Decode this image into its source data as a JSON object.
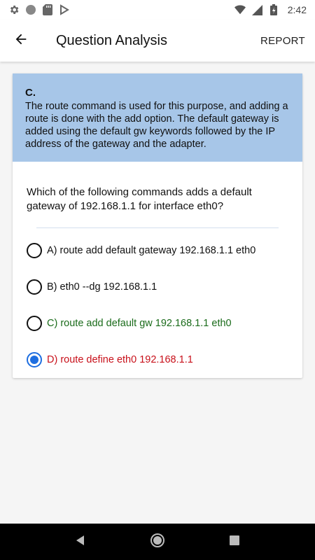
{
  "status_bar": {
    "time": "2:42",
    "icons": [
      "gear-icon",
      "circle-icon",
      "sd-card-icon",
      "play-store-icon",
      "wifi-icon",
      "signal-icon",
      "battery-icon"
    ]
  },
  "app_bar": {
    "title": "Question Analysis",
    "action": "REPORT",
    "back_icon": "arrow-back-icon"
  },
  "answer": {
    "letter": "C.",
    "explanation": "The route command is used for this purpose, and adding a route is done with the add option. The default gateway is added using the default gw keywords followed by the IP address of the gateway and the adapter.",
    "background": "#a7c6e8"
  },
  "question": {
    "text": "Which of the following commands adds a default gateway of 192.168.1.1 for interface eth0?",
    "options": [
      {
        "label": "A) route add default gateway 192.168.1.1 eth0",
        "selected": false,
        "state": "neutral"
      },
      {
        "label": "B) eth0 --dg 192.168.1.1",
        "selected": false,
        "state": "neutral"
      },
      {
        "label": "C) route add default gw 192.168.1.1 eth0",
        "selected": false,
        "state": "correct"
      },
      {
        "label": "D) route define eth0 192.168.1.1",
        "selected": true,
        "state": "wrong"
      }
    ]
  },
  "colors": {
    "correct": "#1a6b1a",
    "wrong": "#c8101a",
    "radio_selected": "#1e6ee0"
  },
  "nav_bar": {
    "icons": [
      "back-triangle-icon",
      "home-circle-icon",
      "recents-square-icon"
    ]
  }
}
